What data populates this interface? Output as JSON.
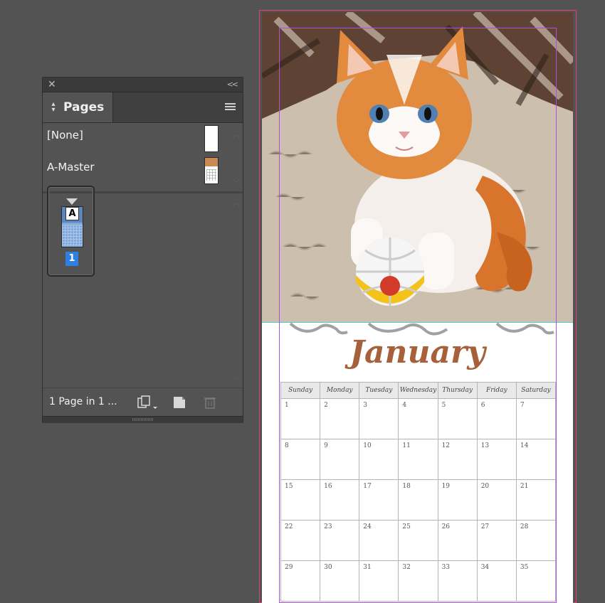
{
  "pages_panel": {
    "close_glyph": "✕",
    "collapse_glyph": "<<",
    "tab_label": "Pages",
    "masters": [
      {
        "label": "[None]"
      },
      {
        "label": "A-Master"
      }
    ],
    "page": {
      "master_letter": "A",
      "number": "1"
    },
    "status": "1 Page in 1 ...",
    "icons": [
      "new-spread-icon",
      "new-page-icon",
      "trash-icon",
      "panel-menu-icon"
    ]
  },
  "document": {
    "month": "January",
    "weekdays": [
      "Sunday",
      "Monday",
      "Tuesday",
      "Wednesday",
      "Thursday",
      "Friday",
      "Saturday"
    ],
    "weeks": [
      [
        "1",
        "2",
        "3",
        "4",
        "5",
        "6",
        "7"
      ],
      [
        "8",
        "9",
        "10",
        "11",
        "12",
        "13",
        "14"
      ],
      [
        "15",
        "16",
        "17",
        "18",
        "19",
        "20",
        "21"
      ],
      [
        "22",
        "23",
        "24",
        "25",
        "26",
        "27",
        "28"
      ],
      [
        "29",
        "30",
        "31",
        "32",
        "33",
        "34",
        "35"
      ]
    ],
    "colors": {
      "month_text": "#a6613a",
      "bleed": "#e0407a",
      "margin_guide": "#b04ee0",
      "frame_edge": "#4fd3dd"
    }
  }
}
